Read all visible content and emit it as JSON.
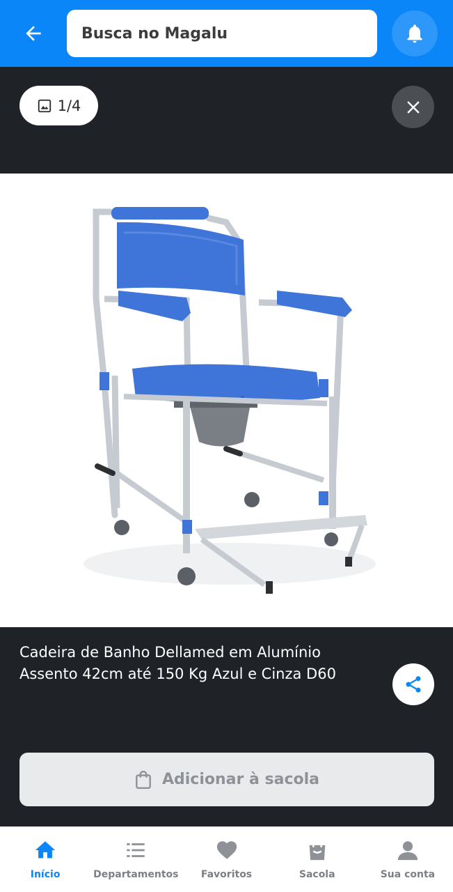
{
  "header": {
    "search_placeholder": "Busca no Magalu",
    "back_icon": "arrow-left-icon",
    "bell_icon": "bell-icon"
  },
  "viewer": {
    "counter": "1/4",
    "counter_icon": "image-icon",
    "close_icon": "close-icon"
  },
  "product": {
    "title": "Cadeira de Banho Dellamed em Alumínio Assento 42cm até 150 Kg Azul e Cinza D60",
    "share_icon": "share-icon",
    "add_label": "Adicionar à sacola"
  },
  "nav": {
    "items": [
      {
        "label": "Início",
        "icon": "home-icon",
        "active": true
      },
      {
        "label": "Departamentos",
        "icon": "list-icon",
        "active": false
      },
      {
        "label": "Favoritos",
        "icon": "heart-icon",
        "active": false
      },
      {
        "label": "Sacola",
        "icon": "bag-icon",
        "active": false
      },
      {
        "label": "Sua conta",
        "icon": "user-icon",
        "active": false
      }
    ]
  },
  "colors": {
    "brand": "#0a86f9",
    "dark_bg": "#1f2227",
    "seat_blue": "#3f74d8"
  }
}
